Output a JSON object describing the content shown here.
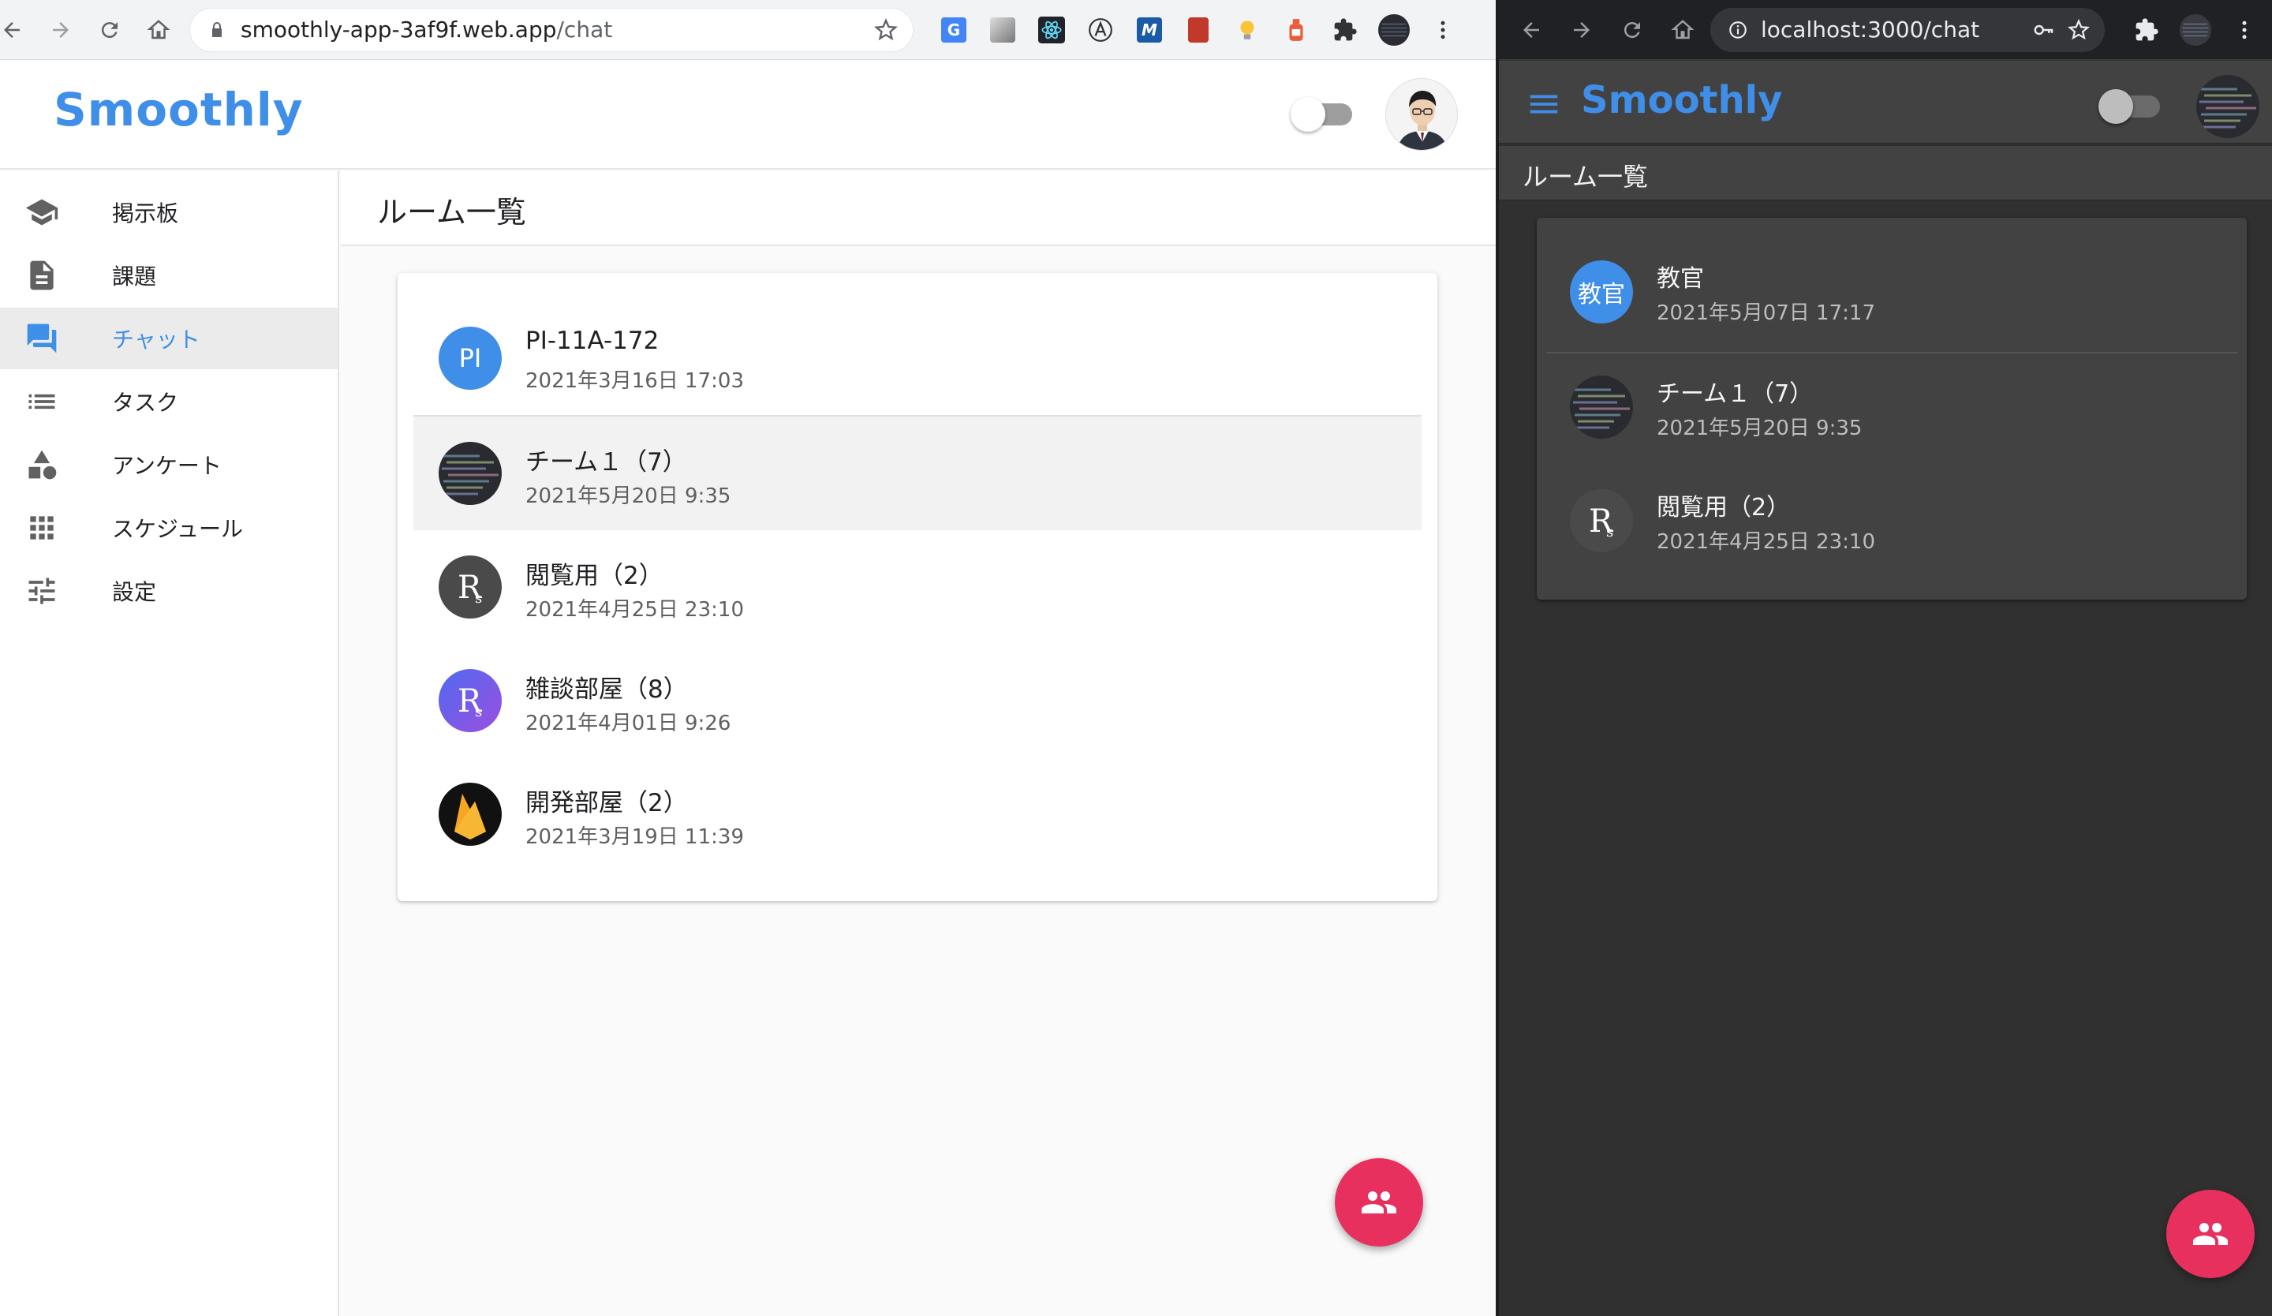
{
  "left_browser": {
    "url_host": "smoothly-app-3af9f.web.app",
    "url_path": "/chat"
  },
  "right_browser": {
    "url": "localhost:3000/chat"
  },
  "app": {
    "brand": "Smoothly",
    "accent_color": "#3f8ee8",
    "fab_color": "#e8305f"
  },
  "sidebar": {
    "items": [
      {
        "label": "掲示板",
        "icon": "school-icon"
      },
      {
        "label": "課題",
        "icon": "document-icon"
      },
      {
        "label": "チャット",
        "icon": "chat-icon"
      },
      {
        "label": "タスク",
        "icon": "list-icon"
      },
      {
        "label": "アンケート",
        "icon": "shapes-icon"
      },
      {
        "label": "スケジュール",
        "icon": "grid-icon"
      },
      {
        "label": "設定",
        "icon": "sliders-icon"
      }
    ],
    "active_index": 2
  },
  "main": {
    "title": "ルーム一覧"
  },
  "rooms_left": [
    {
      "name": "PI-11A-172",
      "date": "2021年3月16日 17:03",
      "avatar_initials": "PI"
    },
    {
      "name": "チーム１（7）",
      "date": "2021年5月20日 9:35"
    },
    {
      "name": "閲覧用（2）",
      "date": "2021年4月25日 23:10"
    },
    {
      "name": "雑談部屋（8）",
      "date": "2021年4月01日 9:26"
    },
    {
      "name": "開発部屋（2）",
      "date": "2021年3月19日 11:39"
    }
  ],
  "rooms_right": [
    {
      "name": "教官",
      "date": "2021年5月07日 17:17",
      "avatar_initials": "教官"
    },
    {
      "name": "チーム１（7）",
      "date": "2021年5月20日 9:35"
    },
    {
      "name": "閲覧用（2）",
      "date": "2021年4月25日 23:10"
    }
  ]
}
